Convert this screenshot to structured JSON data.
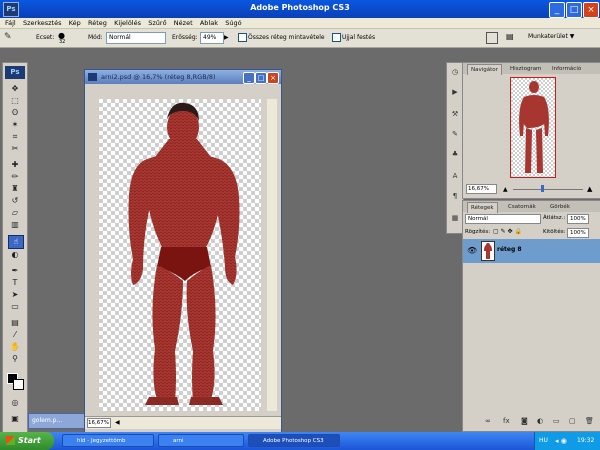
{
  "app": {
    "title": "Adobe Photoshop CS3",
    "logo": "Ps"
  },
  "menu": [
    "Fájl",
    "Szerkesztés",
    "Kép",
    "Réteg",
    "Kijelölés",
    "Szűrő",
    "Nézet",
    "Ablak",
    "Súgó"
  ],
  "options": {
    "brush_label": "Ecset:",
    "brush_size": "32",
    "mode_label": "Mód:",
    "mode_value": "Normál",
    "strength_label": "Erősség:",
    "strength_value": "49%",
    "sample_all_label": "Összes réteg mintavétele",
    "finger_paint_label": "Ujjal festés",
    "workspace_label": "Munkaterület ▼"
  },
  "document": {
    "title": "arni2.psd @ 16,7% (réteg 8,RGB/8)",
    "zoom": "16,67%"
  },
  "minimized_doc": {
    "label": "golem.p..."
  },
  "navigator": {
    "tabs": [
      "Navigátor",
      "Hisztogram",
      "Információ"
    ],
    "zoom": "16,67%"
  },
  "layers_panel": {
    "tabs": [
      "Rétegek",
      "Csatornák",
      "Görbék"
    ],
    "blend_mode": "Normál",
    "opacity_label": "Átlátsz.:",
    "opacity_value": "100%",
    "lock_label": "Rögzítés:",
    "fill_label": "Kitöltés:",
    "fill_value": "100%",
    "layers": [
      {
        "name": "réteg 8",
        "visible": true
      }
    ]
  },
  "taskbar": {
    "start": "Start",
    "items": [
      "hld - Jegyzettömb",
      "arni",
      "Adobe Photoshop CS3"
    ],
    "lang": "HU",
    "time": "19:32"
  },
  "colors": {
    "title_blue": "#0a4ad0",
    "skin": "#a9362e",
    "panel_gray": "#d4d0c8"
  }
}
